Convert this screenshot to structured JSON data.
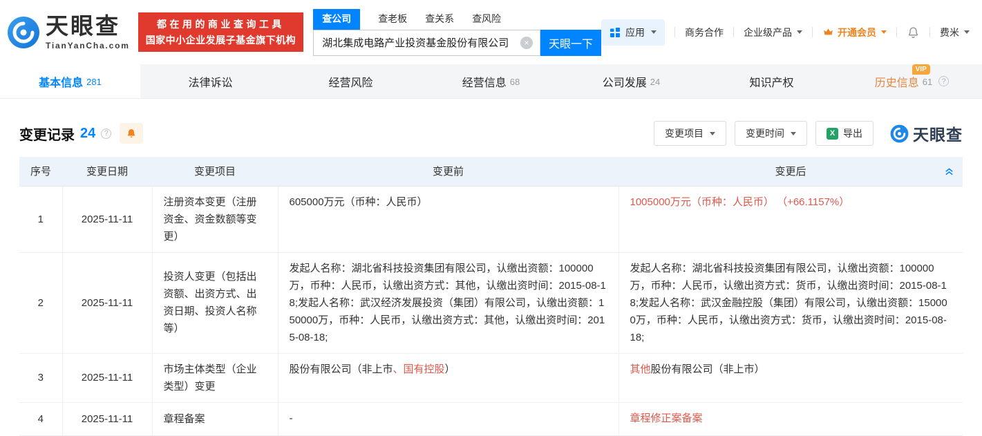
{
  "brand": {
    "logo_title": "天眼查",
    "logo_domain": "TianYanCha.com",
    "slogan_line1": "都在用的商业查询工具",
    "slogan_line2": "国家中小企业发展子基金旗下机构"
  },
  "search": {
    "tabs": [
      {
        "label": "查公司",
        "active": true
      },
      {
        "label": "查老板"
      },
      {
        "label": "查关系"
      },
      {
        "label": "查风险"
      }
    ],
    "value": "湖北集成电路产业投资基金股份有限公司",
    "button_label": "天眼一下"
  },
  "topbar": {
    "apps_label": "应用",
    "cooperation_label": "商务合作",
    "enterprise_label": "企业级产品",
    "vip_label": "开通会员",
    "username": "费米"
  },
  "nav_tabs": [
    {
      "label": "基本信息",
      "count": "281",
      "active": true
    },
    {
      "label": "法律诉讼"
    },
    {
      "label": "经营风险"
    },
    {
      "label": "经营信息",
      "count": "68"
    },
    {
      "label": "公司发展",
      "count": "24"
    },
    {
      "label": "知识产权"
    },
    {
      "label": "历史信息",
      "count": "61",
      "vip_badge": "VIP",
      "help": true,
      "highlight": true
    }
  ],
  "section": {
    "title": "变更记录",
    "count": "24",
    "filter_item_label": "变更项目",
    "filter_time_label": "变更时间",
    "export_label": "导出",
    "watermark": "天眼查"
  },
  "table": {
    "headers": [
      "序号",
      "变更日期",
      "变更项目",
      "变更前",
      "变更后"
    ],
    "rows": [
      {
        "no": "1",
        "date": "2025-11-11",
        "item": "注册资本变更（注册资金、资金数额等变更）",
        "before": [
          {
            "t": "605000万元（币种：人民币）"
          }
        ],
        "after": [
          {
            "t": "1005000万元（币种：人民币） （+66.1157%）",
            "red": true
          }
        ]
      },
      {
        "no": "2",
        "date": "2025-11-11",
        "item": "投资人变更（包括出资额、出资方式、出资日期、投资人名称等）",
        "before": [
          {
            "t": "发起人名称：湖北省科技投资集团有限公司，认缴出资额：100000万，币种：人民币，认缴出资方式：其他，认缴出资时间：2015-08-18;发起人名称：武汉经济发展投资（集团）有限公司，认缴出资额：150000万，币种：人民币，认缴出资方式：其他，认缴出资时间：2015-08-18;"
          }
        ],
        "after": [
          {
            "t": "发起人名称：湖北省科技投资集团有限公司，认缴出资额：100000万，币种：人民币，认缴出资方式：货币，认缴出资时间：2015-08-18;发起人名称：武汉金融控股（集团）有限公司，认缴出资额：150000万，币种：人民币，认缴出资方式：货币，认缴出资时间：2015-08-18;"
          }
        ]
      },
      {
        "no": "3",
        "date": "2025-11-11",
        "item": "市场主体类型（企业类型）变更",
        "before": [
          {
            "t": "股份有限公司（非上市"
          },
          {
            "t": "、国有控股",
            "red": true
          },
          {
            "t": "）"
          }
        ],
        "after": [
          {
            "t": "其他",
            "red": true
          },
          {
            "t": "股份有限公司（非上市）"
          }
        ]
      },
      {
        "no": "4",
        "date": "2025-11-11",
        "item": "章程备案",
        "before": [
          {
            "t": "-"
          }
        ],
        "after": [
          {
            "t": "章程修正案备案",
            "red": true
          }
        ]
      }
    ]
  },
  "colors": {
    "accent": "#0084ff",
    "brand_red": "#e0392e",
    "orange": "#ee8422",
    "red_text": "#e0584a",
    "excel_green": "#21a366"
  }
}
